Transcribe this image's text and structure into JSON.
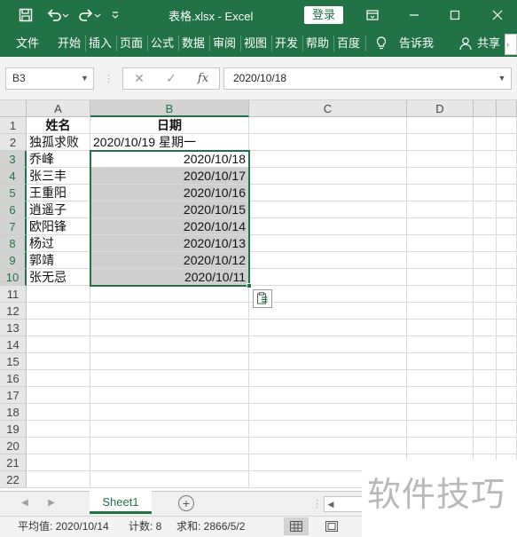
{
  "title_bar": {
    "file_title": "表格.xlsx  -  Excel",
    "login_label": "登录"
  },
  "ribbon_tabs": [
    "文件",
    "开始",
    "插入",
    "页面",
    "公式",
    "数据",
    "审阅",
    "视图",
    "开发",
    "帮助",
    "百度",
    "告诉我",
    "共享"
  ],
  "formula_bar": {
    "name_box": "B3",
    "formula": "2020/10/18",
    "fx_label": "fx"
  },
  "columns": [
    "A",
    "B",
    "C",
    "D"
  ],
  "rows": [
    {
      "num": "1",
      "a": "姓名",
      "b": "日期"
    },
    {
      "num": "2",
      "a": "独孤求败",
      "b": "2020/10/19 星期一"
    },
    {
      "num": "3",
      "a": "乔峰",
      "b": "2020/10/18"
    },
    {
      "num": "4",
      "a": "张三丰",
      "b": "2020/10/17"
    },
    {
      "num": "5",
      "a": "王重阳",
      "b": "2020/10/16"
    },
    {
      "num": "6",
      "a": "逍遥子",
      "b": "2020/10/15"
    },
    {
      "num": "7",
      "a": "欧阳锋",
      "b": "2020/10/14"
    },
    {
      "num": "8",
      "a": "杨过",
      "b": "2020/10/13"
    },
    {
      "num": "9",
      "a": "郭靖",
      "b": "2020/10/12"
    },
    {
      "num": "10",
      "a": "张无忌",
      "b": "2020/10/11"
    },
    {
      "num": "11",
      "a": "",
      "b": ""
    },
    {
      "num": "12",
      "a": "",
      "b": ""
    },
    {
      "num": "13",
      "a": "",
      "b": ""
    },
    {
      "num": "14",
      "a": "",
      "b": ""
    },
    {
      "num": "15",
      "a": "",
      "b": ""
    },
    {
      "num": "16",
      "a": "",
      "b": ""
    },
    {
      "num": "17",
      "a": "",
      "b": ""
    },
    {
      "num": "18",
      "a": "",
      "b": ""
    },
    {
      "num": "19",
      "a": "",
      "b": ""
    },
    {
      "num": "20",
      "a": "",
      "b": ""
    },
    {
      "num": "21",
      "a": "",
      "b": ""
    },
    {
      "num": "22",
      "a": "",
      "b": ""
    }
  ],
  "sheet_tabs": {
    "active": "Sheet1",
    "add_label": "+"
  },
  "status_bar": {
    "average": "平均值: 2020/10/14",
    "count": "计数: 8",
    "sum": "求和: 2866/5/2"
  },
  "watermark": "软件技巧",
  "colors": {
    "accent": "#217346",
    "selection_fill": "#cfcfcf"
  }
}
